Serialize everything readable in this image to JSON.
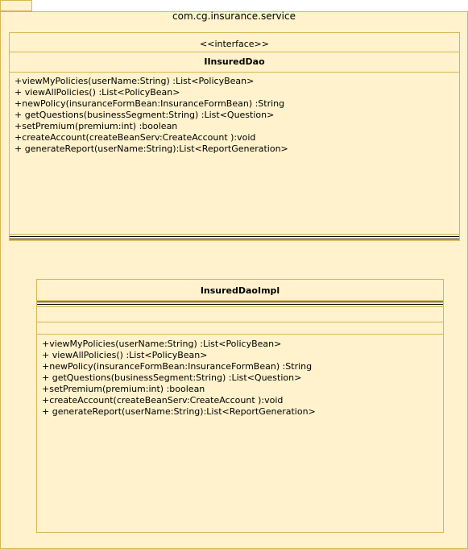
{
  "package": {
    "name": "com.cg.insurance.service"
  },
  "interface_class": {
    "stereotype": "<<interface>>",
    "name": "IInsuredDao",
    "methods": [
      "+viewMyPolicies(userName:String) :List<PolicyBean>",
      "+ viewAllPolicies() :List<PolicyBean>",
      "+newPolicy(insuranceFormBean:InsuranceFormBean) :String",
      "+ getQuestions(businessSegment:String) :List<Question>",
      "+setPremium(premium:int) :boolean",
      "+createAccount(createBeanServ:CreateAccount ):void",
      "+ generateReport(userName:String):List<ReportGeneration>"
    ]
  },
  "impl_class": {
    "name": "InsuredDaoImpl",
    "methods": [
      "+viewMyPolicies(userName:String) :List<PolicyBean>",
      "+ viewAllPolicies() :List<PolicyBean>",
      "+newPolicy(insuranceFormBean:InsuranceFormBean) :String",
      "+ getQuestions(businessSegment:String) :List<Question>",
      "+setPremium(premium:int) :boolean",
      "+createAccount(createBeanServ:CreateAccount ):void",
      "+ generateReport(userName:String):List<ReportGeneration>"
    ]
  },
  "colors": {
    "fill": "#fff2cc",
    "stroke": "#d6b656"
  }
}
